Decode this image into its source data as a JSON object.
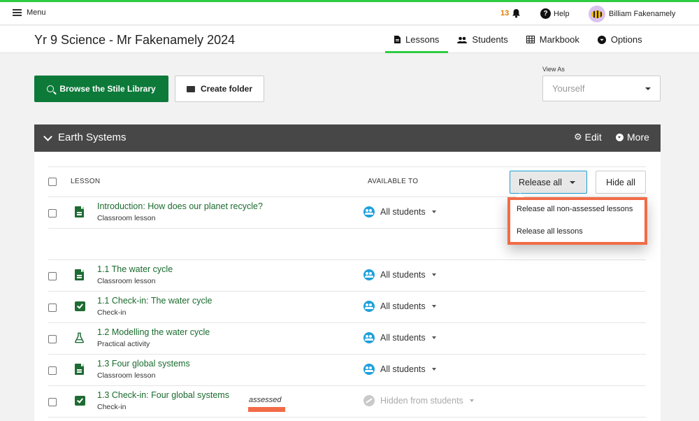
{
  "topbar": {
    "menu_label": "Menu",
    "notification_count": "13",
    "help_label": "Help",
    "user_name": "Billiam Fakenamely"
  },
  "header": {
    "course_title": "Yr 9 Science - Mr Fakenamely 2024",
    "tabs": [
      {
        "label": "Lessons",
        "icon": "document-icon",
        "active": true
      },
      {
        "label": "Students",
        "icon": "people-icon",
        "active": false
      },
      {
        "label": "Markbook",
        "icon": "grid-icon",
        "active": false
      },
      {
        "label": "Options",
        "icon": "chevron-circle-icon",
        "active": false
      }
    ]
  },
  "toolbar": {
    "browse_label": "Browse the Stile Library",
    "create_folder_label": "Create folder",
    "view_as_label": "View As",
    "view_as_value": "Yourself"
  },
  "folder": {
    "name": "Earth Systems",
    "edit_label": "Edit",
    "more_label": "More"
  },
  "table": {
    "col_lesson": "LESSON",
    "col_available": "AVAILABLE TO",
    "release_all_label": "Release all",
    "hide_all_label": "Hide all"
  },
  "release_menu": {
    "items": [
      "Release all non-assessed lessons",
      "Release all lessons"
    ]
  },
  "lessons": [
    {
      "title": "Introduction: How does our planet recycle?",
      "type": "Classroom lesson",
      "icon": "document-icon",
      "available": "All students",
      "hidden": false
    },
    {
      "title": "1.1 The water cycle",
      "type": "Classroom lesson",
      "icon": "document-icon",
      "available": "All students",
      "hidden": false
    },
    {
      "title": "1.1 Check-in: The water cycle",
      "type": "Check-in",
      "icon": "checkin-icon",
      "available": "All students",
      "hidden": false
    },
    {
      "title": "1.2 Modelling the water cycle",
      "type": "Practical activity",
      "icon": "flask-icon",
      "available": "All students",
      "hidden": false
    },
    {
      "title": "1.3 Four global systems",
      "type": "Classroom lesson",
      "icon": "document-icon",
      "available": "All students",
      "hidden": false
    },
    {
      "title": "1.3 Check-in: Four global systems",
      "type": "Check-in",
      "icon": "checkin-icon",
      "available": "Hidden from students",
      "hidden": true,
      "tag": "assessed"
    }
  ],
  "colors": {
    "accent_green": "#2ecc40",
    "primary_button": "#0d7a3a",
    "highlight": "#f26b47",
    "info_blue": "#1ea0dc"
  }
}
